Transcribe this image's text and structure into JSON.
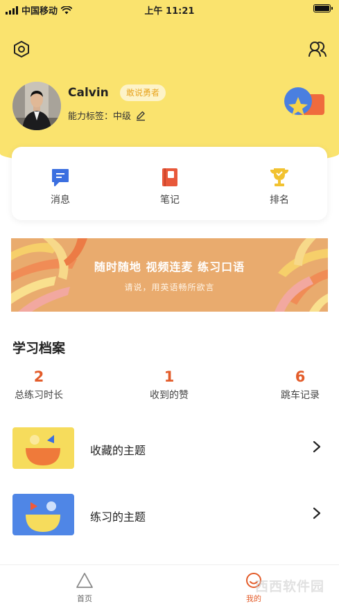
{
  "status_bar": {
    "carrier": "中国移动",
    "time": "上午 11:21",
    "icons": [
      "signal-icon",
      "wifi-icon",
      "battery-icon"
    ]
  },
  "header": {
    "settings_icon": "hexagon-settings-icon",
    "friends_icon": "friends-icon"
  },
  "profile": {
    "name": "Calvin",
    "badge": "敢说勇者",
    "ability_label": "能力标签：中级",
    "edit_icon": "pencil-icon"
  },
  "quick_actions": [
    {
      "label": "消息",
      "icon": "message-icon",
      "color": "#3b6fe0"
    },
    {
      "label": "笔记",
      "icon": "notebook-icon",
      "color": "#e8583a"
    },
    {
      "label": "排名",
      "icon": "trophy-icon",
      "color": "#f2c230"
    }
  ],
  "banner": {
    "title": "随时随地 视频连麦 练习口语",
    "subtitle": "请说，用英语畅所欲言"
  },
  "archive": {
    "title": "学习档案",
    "stats": [
      {
        "value": "2",
        "label": "总练习时长"
      },
      {
        "value": "1",
        "label": "收到的赞"
      },
      {
        "value": "6",
        "label": "跳车记录"
      }
    ]
  },
  "topics": [
    {
      "label": "收藏的主题",
      "thumb_color": "#f6dc5c"
    },
    {
      "label": "练习的主题",
      "thumb_color": "#4f86e6"
    }
  ],
  "tabbar": [
    {
      "label": "首页",
      "icon": "home-triangle-icon"
    },
    {
      "label": "我的",
      "icon": "profile-circle-icon"
    }
  ],
  "watermark": "西西软件园",
  "colors": {
    "header_yellow": "#fae36e",
    "accent_orange": "#e35c2a",
    "banner": "#e9ab6e"
  }
}
